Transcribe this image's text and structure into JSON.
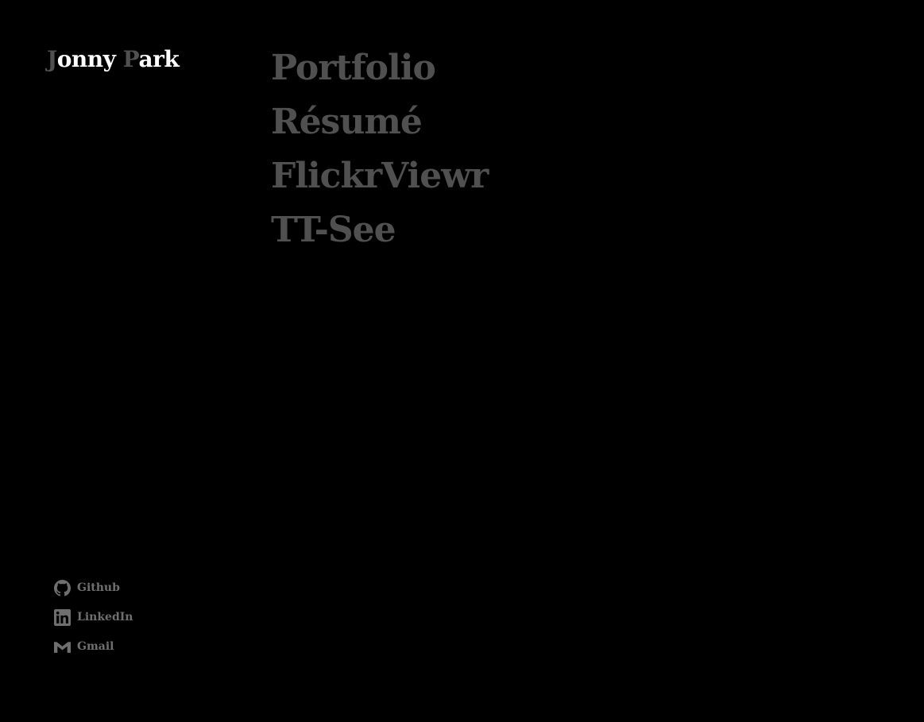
{
  "brand": {
    "first_initial": "J",
    "first_rest": "onny ",
    "last_initial": "P",
    "last_rest": "ark"
  },
  "nav": {
    "items": [
      {
        "label": "Portfolio"
      },
      {
        "label": "Résumé"
      },
      {
        "label": "FlickrViewr"
      },
      {
        "label": "TT-See"
      }
    ]
  },
  "social": {
    "links": [
      {
        "label": "Github",
        "icon": "github-icon"
      },
      {
        "label": "LinkedIn",
        "icon": "linkedin-icon"
      },
      {
        "label": "Gmail",
        "icon": "gmail-icon"
      }
    ]
  },
  "colors": {
    "background": "#000000",
    "brand_text": "#ffffff",
    "dim_text": "#505050",
    "social_text": "#6f6f6f"
  }
}
